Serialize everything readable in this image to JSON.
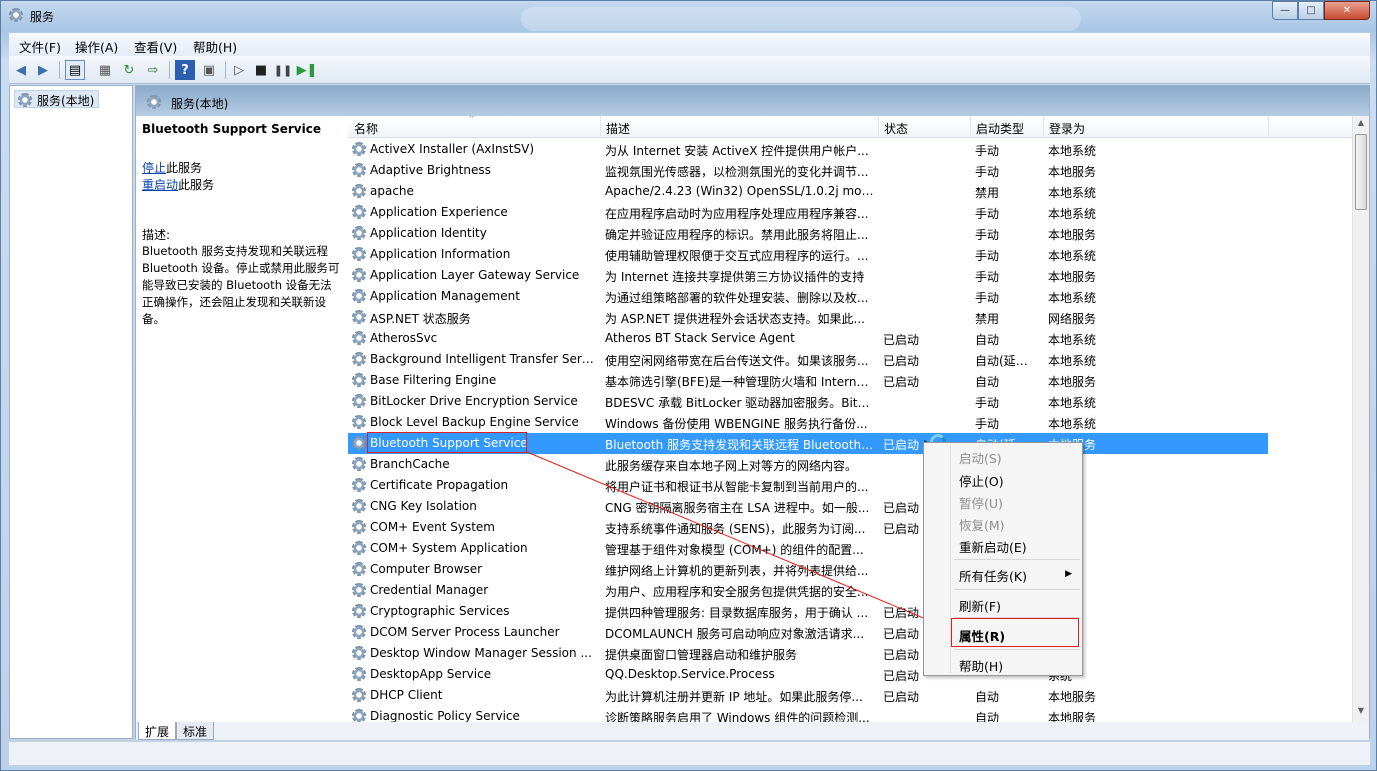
{
  "window": {
    "title": "服务",
    "buttons": {
      "minimize": "—",
      "maximize": "□",
      "close": "✕"
    }
  },
  "menu": [
    "文件(F)",
    "操作(A)",
    "查看(V)",
    "帮助(H)"
  ],
  "toolbar": {
    "icons": [
      "back-arrow-icon",
      "forward-arrow-icon",
      "console-tree-icon",
      "properties-icon",
      "refresh-icon",
      "export-icon",
      "help-icon",
      "view-icon",
      "play-icon",
      "stop-icon",
      "pause-icon",
      "resume-icon"
    ]
  },
  "tree": {
    "root": "服务(本地)"
  },
  "panel": {
    "title": "服务(本地)"
  },
  "description": {
    "service_name": "Bluetooth Support Service",
    "stop_link": "停止",
    "stop_suffix": "此服务",
    "restart_link": "重启动",
    "restart_suffix": "此服务",
    "label": "描述:",
    "text": "Bluetooth 服务支持发现和关联远程 Bluetooth 设备。停止或禁用此服务可能导致已安装的 Bluetooth 设备无法正确操作，还会阻止发现和关联新设备。"
  },
  "columns": {
    "name": "名称",
    "desc": "描述",
    "status": "状态",
    "type": "启动类型",
    "logon": "登录为"
  },
  "services": [
    {
      "name": "ActiveX Installer (AxInstSV)",
      "desc": "为从 Internet 安装 ActiveX 控件提供用户帐户...",
      "status": "",
      "type": "手动",
      "logon": "本地系统"
    },
    {
      "name": "Adaptive Brightness",
      "desc": "监视氛围光传感器，以检测氛围光的变化并调节...",
      "status": "",
      "type": "手动",
      "logon": "本地服务"
    },
    {
      "name": "apache",
      "desc": "Apache/2.4.23 (Win32) OpenSSL/1.0.2j mod_...",
      "status": "",
      "type": "禁用",
      "logon": "本地系统"
    },
    {
      "name": "Application Experience",
      "desc": "在应用程序启动时为应用程序处理应用程序兼容...",
      "status": "",
      "type": "手动",
      "logon": "本地系统"
    },
    {
      "name": "Application Identity",
      "desc": "确定并验证应用程序的标识。禁用此服务将阻止...",
      "status": "",
      "type": "手动",
      "logon": "本地服务"
    },
    {
      "name": "Application Information",
      "desc": "使用辅助管理权限便于交互式应用程序的运行。...",
      "status": "",
      "type": "手动",
      "logon": "本地系统"
    },
    {
      "name": "Application Layer Gateway Service",
      "desc": "为 Internet 连接共享提供第三方协议插件的支持",
      "status": "",
      "type": "手动",
      "logon": "本地服务"
    },
    {
      "name": "Application Management",
      "desc": "为通过组策略部署的软件处理安装、删除以及枚...",
      "status": "",
      "type": "手动",
      "logon": "本地系统"
    },
    {
      "name": "ASP.NET 状态服务",
      "desc": "为 ASP.NET 提供进程外会话状态支持。如果此...",
      "status": "",
      "type": "禁用",
      "logon": "网络服务"
    },
    {
      "name": "AtherosSvc",
      "desc": "Atheros BT Stack Service Agent",
      "status": "已启动",
      "type": "自动",
      "logon": "本地系统"
    },
    {
      "name": "Background Intelligent Transfer Servi...",
      "desc": "使用空闲网络带宽在后台传送文件。如果该服务...",
      "status": "已启动",
      "type": "自动(延迟...",
      "logon": "本地系统"
    },
    {
      "name": "Base Filtering Engine",
      "desc": "基本筛选引擎(BFE)是一种管理防火墙和 Interne...",
      "status": "已启动",
      "type": "自动",
      "logon": "本地服务"
    },
    {
      "name": "BitLocker Drive Encryption Service",
      "desc": "BDESVC 承载 BitLocker 驱动器加密服务。BitL...",
      "status": "",
      "type": "手动",
      "logon": "本地系统"
    },
    {
      "name": "Block Level Backup Engine Service",
      "desc": "Windows 备份使用 WBENGINE 服务执行备份...",
      "status": "",
      "type": "手动",
      "logon": "本地系统"
    },
    {
      "name": "Bluetooth Support Service",
      "desc": "Bluetooth 服务支持发现和关联远程 Bluetooth ...",
      "status": "已启动",
      "type": "自动(延迟...",
      "logon": "本地服务"
    },
    {
      "name": "BranchCache",
      "desc": "此服务缓存来自本地子网上对等方的网络内容。",
      "status": "",
      "type": "",
      "logon": "服务"
    },
    {
      "name": "Certificate Propagation",
      "desc": "将用户证书和根证书从智能卡复制到当前用户的...",
      "status": "",
      "type": "",
      "logon": "系统"
    },
    {
      "name": "CNG Key Isolation",
      "desc": "CNG 密钥隔离服务宿主在 LSA 进程中。如一般...",
      "status": "已启动",
      "type": "",
      "logon": "系统"
    },
    {
      "name": "COM+ Event System",
      "desc": "支持系统事件通知服务 (SENS)，此服务为订阅...",
      "status": "已启动",
      "type": "",
      "logon": "服务"
    },
    {
      "name": "COM+ System Application",
      "desc": "管理基于组件对象模型 (COM+) 的组件的配置...",
      "status": "",
      "type": "",
      "logon": "系统"
    },
    {
      "name": "Computer Browser",
      "desc": "维护网络上计算机的更新列表，并将列表提供给...",
      "status": "",
      "type": "",
      "logon": "系统"
    },
    {
      "name": "Credential Manager",
      "desc": "为用户、应用程序和安全服务包提供凭据的安全...",
      "status": "",
      "type": "",
      "logon": "系统"
    },
    {
      "name": "Cryptographic Services",
      "desc": "提供四种管理服务: 目录数据库服务，用于确认 ...",
      "status": "已启动",
      "type": "",
      "logon": "服务"
    },
    {
      "name": "DCOM Server Process Launcher",
      "desc": "DCOMLAUNCH 服务可启动响应对象激活请求...",
      "status": "已启动",
      "type": "",
      "logon": "系统"
    },
    {
      "name": "Desktop Window Manager Session ...",
      "desc": "提供桌面窗口管理器启动和维护服务",
      "status": "已启动",
      "type": "",
      "logon": "系统"
    },
    {
      "name": "DesktopApp Service",
      "desc": "QQ.Desktop.Service.Process",
      "status": "已启动",
      "type": "",
      "logon": "系统"
    },
    {
      "name": "DHCP Client",
      "desc": "为此计算机注册并更新 IP 地址。如果此服务停...",
      "status": "已启动",
      "type": "自动",
      "logon": "本地服务"
    },
    {
      "name": "Diagnostic Policy Service",
      "desc": "诊断策略服务启用了 Windows 组件的问题检测...",
      "status": "",
      "type": "自动",
      "logon": "本地服务"
    }
  ],
  "context_menu": {
    "start": "启动(S)",
    "stop": "停止(O)",
    "pause": "暂停(U)",
    "resume": "恢复(M)",
    "restart": "重新启动(E)",
    "all_tasks": "所有任务(K)",
    "refresh": "刷新(F)",
    "properties": "属性(R)",
    "help": "帮助(H)"
  },
  "tabs": {
    "extended": "扩展",
    "standard": "标准"
  },
  "annotation_color": "#e02020",
  "selection_color": "#3399ff"
}
